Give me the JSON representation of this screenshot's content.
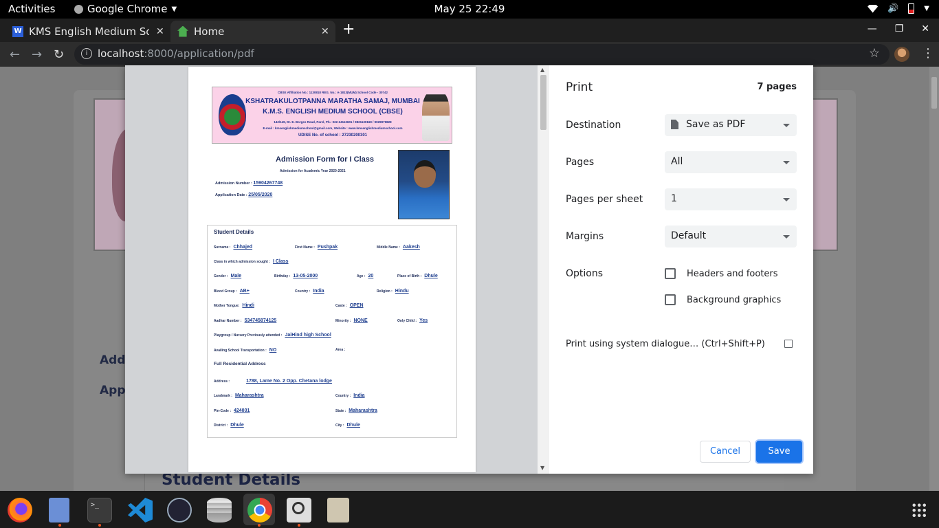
{
  "topbar": {
    "activities": "Activities",
    "app": "Google Chrome",
    "clock": "May 25  22:49"
  },
  "tabs": [
    {
      "title": "KMS English Medium School",
      "close": "✕"
    },
    {
      "title": "Home",
      "close": "✕"
    }
  ],
  "toolbar": {
    "url_host": "localhost",
    "url_rest": ":8000/application/pdf"
  },
  "page_behind": {
    "label_admission": "Addm",
    "label_application": "Appli",
    "section": "Student Details"
  },
  "dialog": {
    "title": "Print",
    "page_count": "7 pages",
    "destination_label": "Destination",
    "destination_value": "Save as PDF",
    "pages_label": "Pages",
    "pages_value": "All",
    "per_sheet_label": "Pages per sheet",
    "per_sheet_value": "1",
    "margins_label": "Margins",
    "margins_value": "Default",
    "options_label": "Options",
    "opt_headers": "Headers and footers",
    "opt_background": "Background graphics",
    "system_dialog": "Print using system dialogue… (Ctrl+Shift+P)",
    "cancel": "Cancel",
    "save": "Save"
  },
  "preview": {
    "letterhead": {
      "line1": "CBSE Affiliation No.: 1130818          REG. No.: A-1813(MUM)          School Code - 30742",
      "line2": "KSHATRAKULOTPANNA MARATHA SAMAJ, MUMBAI",
      "line3": "K.M.S. ENGLISH MEDIUM SCHOOL (CBSE)",
      "line4": "142/149, Dr. E. Borges Road, Parel, Ph.: 022-24113601 / 9821130169 / 9029979828",
      "line5": "E-mail : kmsenglishmediumschool@gmail.com, Website : www.kmsenglishmediumschool.com",
      "line6": "UDISE No. of school : 27230200301"
    },
    "form_title": "Admission Form for I Class",
    "form_sub": "Admission for Academic Year 2020-2021",
    "admission_label": "Admission Number :",
    "admission_value": "15904267748",
    "appdate_label": "Application Date :",
    "appdate_value": "25/05/2020",
    "student_details": "Student Details",
    "fields": {
      "surname_l": "Surname :",
      "surname_v": "Chhajed",
      "first_l": "First Name :",
      "first_v": "Pushpak",
      "middle_l": "Middle Name :",
      "middle_v": "Aakesh",
      "class_l": "Class in which admission sought :",
      "class_v": "I Class",
      "gender_l": "Gender :",
      "gender_v": "Male",
      "bday_l": "Birthday :",
      "bday_v": "13-05-2000",
      "age_l": "Age :",
      "age_v": "20",
      "pob_l": "Place of Birth :",
      "pob_v": "Dhule",
      "blood_l": "Blood Group :",
      "blood_v": "AB+",
      "country_l": "Country :",
      "country_v": "India",
      "religion_l": "Religion :",
      "religion_v": "Hindu",
      "tongue_l": "Mother Tongue:",
      "tongue_v": "Hindi",
      "caste_l": "Caste :",
      "caste_v": "OPEN",
      "aadhar_l": "Aadhar Number :",
      "aadhar_v": "534745874125",
      "minority_l": "Minority :",
      "minority_v": "NONE",
      "only_l": "Only Child :",
      "only_v": "Yes",
      "play_l": "Playgroup / Nursery Previously attended :",
      "play_v": "JaiHind high School",
      "trans_l": "Availing School Transportation :",
      "trans_v": "NO",
      "area_l": "Area :",
      "addr_section": "Full Residential Address",
      "address_l": "Address :",
      "address_v": "1788, Lame No. 2 Opp. Chetana lodge",
      "landmark_l": "Landmark :",
      "landmark_v": "Maharashtra",
      "country2_l": "Country :",
      "country2_v": "India",
      "pin_l": "Pin-Code :",
      "pin_v": "424001",
      "state_l": "State :",
      "state_v": "Maharashtra",
      "district_l": "District :",
      "district_v": "Dhule",
      "city_l": "City :",
      "city_v": "Dhule"
    }
  },
  "dock": [
    "firefox-icon",
    "files-icon",
    "terminal-icon",
    "vscode-icon",
    "network-icon",
    "database-icon",
    "chrome-icon",
    "image-viewer-icon",
    "archive-icon",
    "app-grid-icon"
  ]
}
